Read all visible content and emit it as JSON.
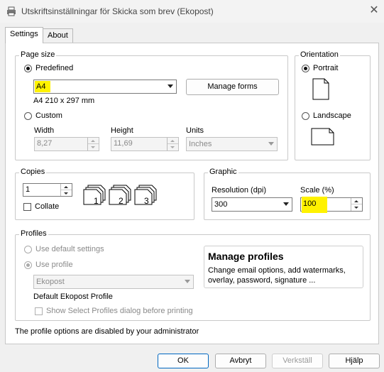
{
  "window": {
    "title": "Utskriftsinställningar för Skicka som brev (Ekopost)"
  },
  "tabs": [
    {
      "label": "Settings"
    },
    {
      "label": "About"
    }
  ],
  "page_size": {
    "legend": "Page size",
    "predefined_label": "Predefined",
    "predefined_value": "A4",
    "size_desc": "A4 210 x 297 mm",
    "manage_forms": "Manage forms",
    "custom_label": "Custom",
    "width_label": "Width",
    "width_value": "8,27",
    "height_label": "Height",
    "height_value": "11,69",
    "units_label": "Units",
    "units_value": "Inches"
  },
  "orientation": {
    "legend": "Orientation",
    "portrait": "Portrait",
    "landscape": "Landscape"
  },
  "copies": {
    "legend": "Copies",
    "value": "1",
    "collate": "Collate",
    "collate_pages": [
      "1",
      "2",
      "3"
    ]
  },
  "graphic": {
    "legend": "Graphic",
    "resolution_label": "Resolution (dpi)",
    "resolution_value": "300",
    "scale_label": "Scale (%)",
    "scale_value": "100"
  },
  "profiles": {
    "legend": "Profiles",
    "use_default": "Use default settings",
    "use_profile": "Use profile",
    "profile_value": "Ekopost",
    "default_profile_name": "Default Ekopost Profile",
    "show_dialog": "Show Select Profiles dialog before printing",
    "manage_title": "Manage profiles",
    "manage_desc": "Change email options, add watermarks, overlay, password, signature ..."
  },
  "notice": "The profile options are disabled by your administrator",
  "buttons": {
    "ok": "OK",
    "cancel": "Avbryt",
    "apply": "Verkställ",
    "help": "Hjälp"
  },
  "colors": {
    "highlight": "#fff200",
    "primary_border": "#0067c0"
  }
}
